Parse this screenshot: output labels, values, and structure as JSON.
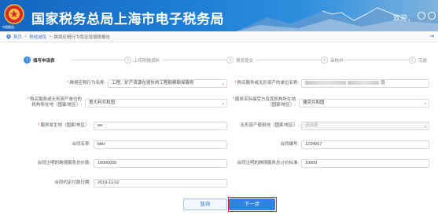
{
  "header": {
    "title": "国家税务总局上海市电子税务局",
    "emblem_caption": "中国税务",
    "welcome": "欢迎，",
    "colors": {
      "primary": "#1565c0",
      "accent": "#2f84e0",
      "highlight": "#e4262b"
    }
  },
  "breadcrumb": {
    "items": [
      "首页",
      "税收减免",
      "跨境应税行为免征增值税报告"
    ],
    "separator": ">"
  },
  "steps": [
    {
      "num": "1",
      "label": "填写申请表",
      "state": "active"
    },
    {
      "num": "2",
      "label": "上传附报资料",
      "state": "pending"
    },
    {
      "num": "3",
      "label": "预览提交",
      "state": "pending"
    },
    {
      "num": "4",
      "label": "审核中",
      "state": "pending"
    },
    {
      "num": "5",
      "label": "完成",
      "state": "pending"
    }
  ],
  "form": {
    "cross_border_behavior": {
      "label": "跨境应税行为名称:",
      "value": "工程、矿产资源在境外的工程勘察勘探服务",
      "required": true
    },
    "buyer_company": {
      "label": "购买服务或无形资产的单位名称:",
      "value_suffix": "司",
      "required": true
    },
    "buyer_location": {
      "label": "购买服务或无形资产单位的机构所在地（国家/地区）:",
      "value": "意大利共和国",
      "required": true
    },
    "service_location": {
      "label": "服务实际接受方及其机构所在地（国家/地区）:",
      "value": "捷克共和国",
      "required": true
    },
    "service_occur_place": {
      "label": "服务发生地（国家/地区）:",
      "value": "aa",
      "required": true
    },
    "intangible_use_place": {
      "label": "无形资产使用地（国家/地区）:",
      "placeholder": "请选择",
      "required": false
    },
    "contract_name": {
      "label": "合同名称:",
      "value": "bbb"
    },
    "contract_number": {
      "label": "合同编号:",
      "value": "1234567"
    },
    "contract_total_amount": {
      "label": "合同注明的跨境服务总价款:",
      "value": "10000000"
    },
    "contract_cumulative": {
      "label": "合同注明的跨境服务总计价标准:",
      "value": "10000"
    },
    "contract_sign_date": {
      "label": "合同约定付款日期:",
      "value": "2019-11-02"
    }
  },
  "buttons": {
    "save": "暂存",
    "next": "下一步"
  }
}
